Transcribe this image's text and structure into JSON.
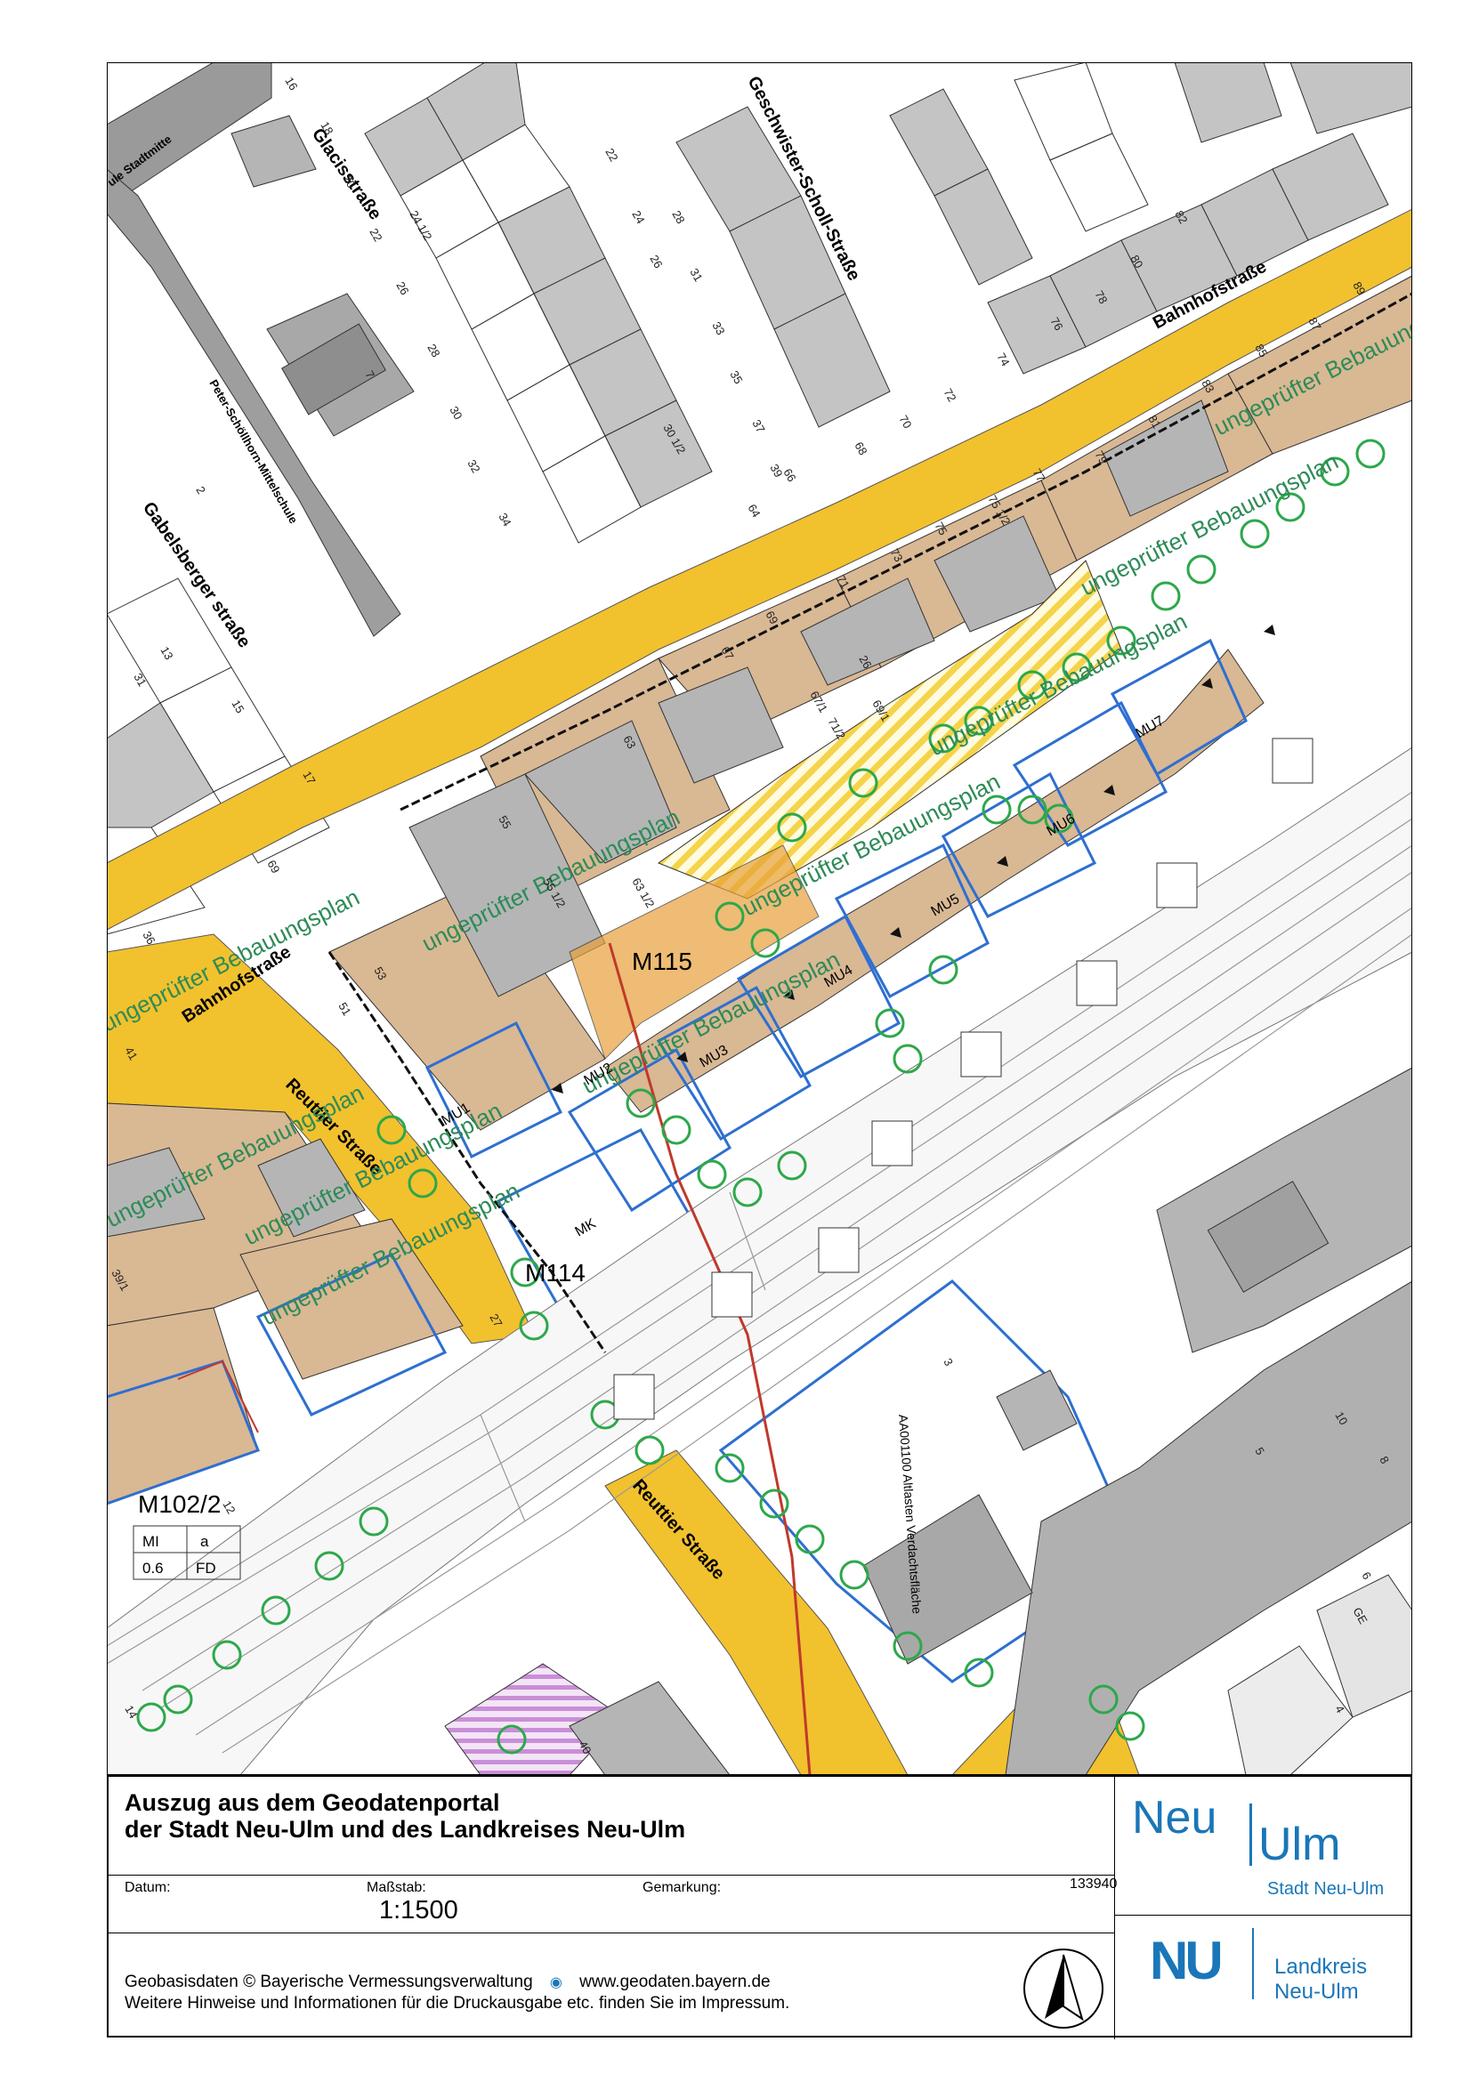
{
  "map": {
    "streets": {
      "glacis": "Glacisstraße",
      "scholl": "Geschwister-Scholl-Straße",
      "bahnhof_top": "Bahnhofstraße",
      "bahnhof_left": "Bahnhofstraße",
      "gabelsberger": "Gabelsberger straße",
      "reuttier_left": "Reuttier Straße",
      "reuttier_bottom": "Reuttier Straße"
    },
    "school": "Peter-Schöllhorn-Mittelschule",
    "school_top": "ule Stadtmitte",
    "plan_note": "ungeprüfter Bebauungsplan",
    "plan_codes": [
      "M115",
      "M114",
      "M102/2"
    ],
    "zones": [
      "MU1",
      "MU2",
      "MU3",
      "MU4",
      "MU5",
      "MU6",
      "MU7",
      "MK"
    ],
    "table_values": [
      "MI",
      "a",
      "0.6",
      "FD"
    ],
    "special_label": "AA001100 Altlasten Verdachtsfläche",
    "house_numbers": [
      "16",
      "18",
      "20",
      "22",
      "24 1/2",
      "26",
      "28",
      "30",
      "32",
      "34",
      "22",
      "24",
      "26",
      "28",
      "31",
      "33",
      "35",
      "37",
      "39",
      "30 1/2",
      "64",
      "66",
      "68",
      "70",
      "72",
      "74",
      "76",
      "78",
      "80",
      "82",
      "67",
      "69",
      "71",
      "73",
      "75",
      "75 1/2",
      "77",
      "79",
      "81",
      "83",
      "85",
      "87",
      "89",
      "63",
      "55",
      "55 1/2",
      "53",
      "51",
      "41",
      "39/1",
      "27",
      "12",
      "14",
      "36",
      "13",
      "15",
      "17",
      "69",
      "31",
      "2",
      "5",
      "7",
      "40",
      "3",
      "4",
      "6",
      "8",
      "10",
      "GE",
      "26",
      "71/2",
      "67/1",
      "69/1",
      "63 1/2"
    ]
  },
  "legend": {
    "title_line1": "Auszug aus dem Geodatenportal",
    "title_line2": "der Stadt Neu-Ulm und des Landkreises Neu-Ulm",
    "datum_label": "Datum:",
    "massstab_label": "Maßstab:",
    "scale": "1:1500",
    "gemarkung_label": "Gemarkung:",
    "gemarkung_value": "133940",
    "footer_line1": "Geobasisdaten © Bayerische Vermessungsverwaltung",
    "footer_url": "www.geodaten.bayern.de",
    "footer_line2": "Weitere Hinweise und Informationen für die Druckausgabe etc. finden Sie im Impressum.",
    "logo_neu": "Neu",
    "logo_ulm": "Ulm",
    "logo_stadt": "Stadt Neu-Ulm",
    "logo_nu": "NU",
    "logo_landkreis_1": "Landkreis",
    "logo_landkreis_2": "Neu-Ulm"
  },
  "colors": {
    "street_yellow": "#F2C12E",
    "parcel_brown": "#D9B894",
    "building_gray": "#B8B8B8",
    "plan_green": "#2E8B57",
    "tree_green": "#2DA84A",
    "blue_border": "#2E6FD0",
    "red_line": "#C0392B",
    "purple_hatch": "#C88FD6",
    "logo_blue": "#1A76B8"
  }
}
